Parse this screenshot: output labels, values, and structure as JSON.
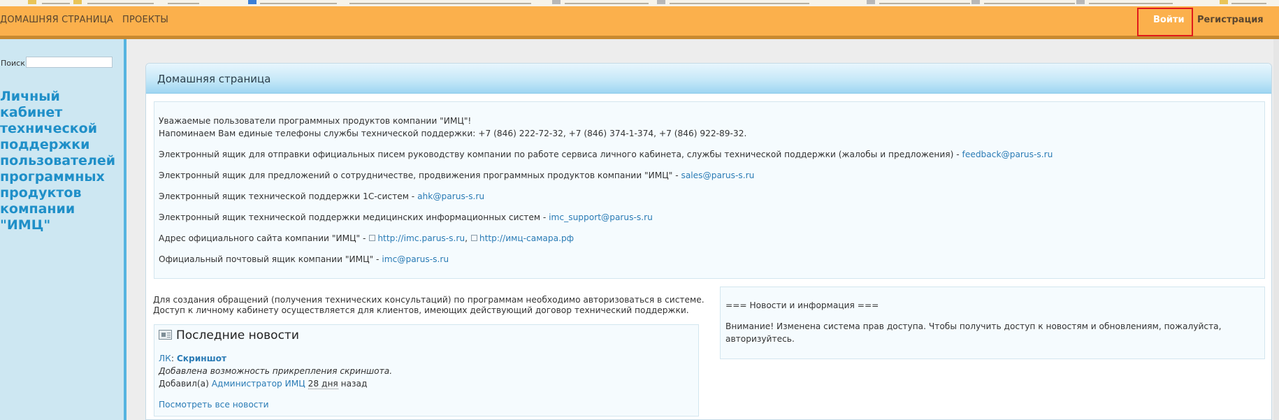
{
  "topnav": {
    "home": "ДОМАШНЯЯ СТРАНИЦА",
    "projects": "ПРОЕКТЫ",
    "login": "Войти",
    "register": "Регистрация"
  },
  "sidebar": {
    "search_label": "Поиск",
    "search_value": "",
    "title_lines": [
      "Личный кабинет",
      "технической",
      "поддержки",
      "пользователей",
      "программных",
      "продуктов",
      "компании \"ИМЦ\""
    ]
  },
  "panel": {
    "title": "Домашняя страница"
  },
  "info": {
    "greeting": "Уважаемые пользователи программных продуктов компании \"ИМЦ\"!",
    "phones": "Напоминаем Вам единые телефоны службы технической поддержки: +7 (846) 222-72-32, +7 (846) 374-1-374, +7 (846) 922-89-32.",
    "feedback_text": "Электронный ящик для отправки официальных писем руководству компании по работе сервиса личного кабинета, службы технической поддержки (жалобы и предложения) - ",
    "feedback_link": "feedback@parus-s.ru",
    "sales_text": "Электронный ящик для предложений о сотрудничестве, продвижения программных продуктов компании \"ИМЦ\" - ",
    "sales_link": "sales@parus-s.ru",
    "ahk_text": "Электронный ящик технической поддержки 1С-систем - ",
    "ahk_link": "ahk@parus-s.ru",
    "imc_support_text": "Электронный ящик технической поддержки медицинских информационных систем - ",
    "imc_support_link": "imc_support@parus-s.ru",
    "site_text": "Адрес официального сайта компании \"ИМЦ\" - ",
    "site_link1": "http://imc.parus-s.ru",
    "site_sep": ",",
    "site_link2": "http://имц-самара.рф",
    "mail_text": "Официальный почтовый ящик компании \"ИМЦ\" - ",
    "mail_link": "imc@parus-s.ru"
  },
  "intro": {
    "line1": "Для создания обращений (получения технических консультаций) по программам необходимо авторизоваться в системе.",
    "line2": "Доступ к личному кабинету осуществляется для клиентов, имеющих действующий договор технический поддержки."
  },
  "news": {
    "heading": "Последние новости",
    "project_link": "ЛК",
    "colon": ": ",
    "item_title": "Скриншот",
    "item_desc": "Добавлена возможность прикрепления скриншота.",
    "added_by_prefix": "Добавил(а) ",
    "author": "Администратор ИМЦ",
    "age": "28 дня",
    "age_suffix": " назад",
    "all_news": "Посмотреть все новости"
  },
  "right": {
    "heading": "=== Новости и информация ===",
    "notice_line1": "Внимание! Изменена система прав доступа. Чтобы получить доступ к новостям и обновлениям, пожалуйста,",
    "notice_line2": "авторизуйтесь."
  }
}
